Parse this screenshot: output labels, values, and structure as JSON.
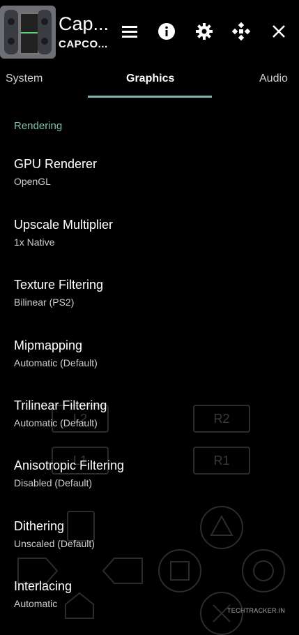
{
  "header": {
    "title": "Cap...",
    "subtitle": "CAPCO...",
    "icons": [
      "menu-icon",
      "info-icon",
      "settings-icon",
      "gamepad-icon",
      "close-icon"
    ]
  },
  "tabs": [
    {
      "label": "System",
      "active": false
    },
    {
      "label": "Graphics",
      "active": true
    },
    {
      "label": "Audio",
      "active": false
    }
  ],
  "colors": {
    "accent": "#79b8ad",
    "section_label": "#7fbfb1",
    "background": "#000000"
  },
  "section": {
    "label": "Rendering"
  },
  "settings": [
    {
      "name": "GPU Renderer",
      "value": "OpenGL"
    },
    {
      "name": "Upscale Multiplier",
      "value": "1x Native"
    },
    {
      "name": "Texture Filtering",
      "value": "Bilinear (PS2)"
    },
    {
      "name": "Mipmapping",
      "value": "Automatic (Default)"
    },
    {
      "name": "Trilinear Filtering",
      "value": "Automatic (Default)"
    },
    {
      "name": "Anisotropic Filtering",
      "value": "Disabled (Default)"
    },
    {
      "name": "Dithering",
      "value": "Unscaled (Default)"
    },
    {
      "name": "Interlacing",
      "value": "Automatic"
    }
  ],
  "overlay": {
    "r2": "R2",
    "r1": "R1",
    "l2": "L2",
    "l1": "L1"
  },
  "watermark": "TECHTRACKER.IN"
}
